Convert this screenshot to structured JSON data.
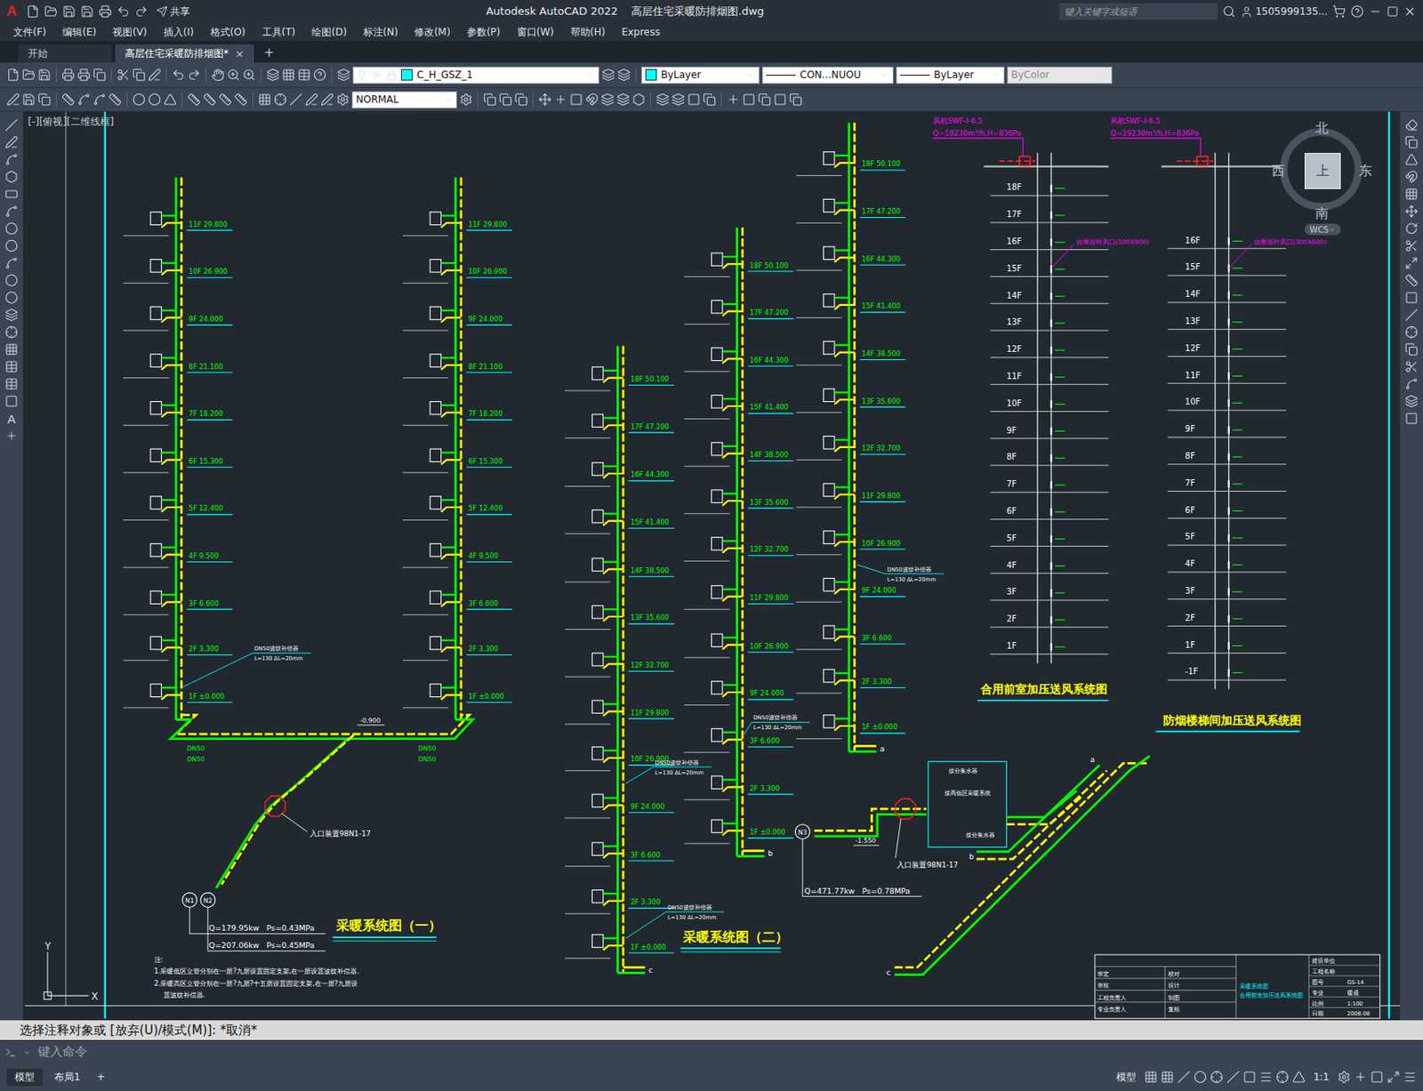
{
  "window": {
    "logo": "A",
    "title": "Autodesk AutoCAD 2022    高层住宅采暖防排烟图.dwg",
    "share": "共享",
    "search_placeholder": "键入关键字或短语",
    "user": "1505999135..."
  },
  "menu": [
    "文件(F)",
    "编辑(E)",
    "视图(V)",
    "插入(I)",
    "格式(O)",
    "工具(T)",
    "绘图(D)",
    "标注(N)",
    "修改(M)",
    "参数(P)",
    "窗口(W)",
    "帮助(H)",
    "Express"
  ],
  "doc_tabs": [
    {
      "label": "开始",
      "selected": false,
      "closable": false
    },
    {
      "label": "高层住宅采暖防排烟图*",
      "selected": true,
      "closable": true
    }
  ],
  "doc_tab_close": "×",
  "doc_tab_add": "+",
  "properties": {
    "layer": "C_H_GSZ_1",
    "color": "ByLayer",
    "linetype": "CON...NUOU",
    "lineweight": "ByLayer",
    "plotstyle": "ByColor"
  },
  "style_combo": "NORMAL",
  "text_tool": "A",
  "viewport_label": "[-][俯视][二维线框]",
  "viewcube": {
    "north": "北",
    "south": "南",
    "east": "东",
    "west": "西",
    "face": "上",
    "ucs": "WCS"
  },
  "ucs_axes": {
    "x": "X",
    "y": "Y"
  },
  "drawing": {
    "system1": {
      "title": "采暖系统图（一）",
      "risers": [
        {
          "levels": [
            "11F 29.800",
            "10F 26.900",
            "9F 24.000",
            "8F 21.100",
            "7F 18.200",
            "6F 15.300",
            "5F 12.400",
            "4F 9.500",
            "3F 6.600",
            "2F 3.300",
            "1F ±0.000"
          ]
        },
        {
          "levels": [
            "11F 29.800",
            "10F 26.900",
            "9F 24.000",
            "8F 21.100",
            "7F 18.200",
            "6F 15.300",
            "5F 12.400",
            "4F 9.500",
            "3F 6.600",
            "2F 3.300",
            "1F ±0.000"
          ]
        }
      ],
      "elevation": "-0.900",
      "entry": "入口装置98N1-17",
      "nodes": [
        "N1",
        "N2"
      ],
      "loads": [
        "Q=179.95kw   Ps=0.43MPa",
        "Q=207.06kw   Ps=0.45MPa"
      ],
      "pipe_labels": [
        "DN50",
        "DN50",
        "DN50",
        "DN50"
      ],
      "callout": [
        "DN50波纹补偿器",
        "L=130  ΔL=20mm"
      ],
      "notes": [
        "注:",
        "1.采暖低区立管分别在一层?九层设置固定支架,在一层设置波纹补偿器.",
        "2.采暖高区立管分别在一层?九层?十五层设置固定支架,在一层?九层设",
        "置波纹补偿器."
      ]
    },
    "system2": {
      "title": "采暖系统图（二）",
      "risers": [
        {
          "levels": [
            "18F 50.100",
            "17F 47.200",
            "16F 44.300",
            "15F 41.400",
            "14F 38.500",
            "13F 35.600",
            "12F 32.700",
            "11F 29.800",
            "10F 26.900",
            "9F 24.000",
            "3F 6.600",
            "2F 3.300",
            "1F ±0.000"
          ],
          "end": "c"
        },
        {
          "levels": [
            "18F 50.100",
            "17F 47.200",
            "16F 44.300",
            "15F 41.400",
            "14F 38.500",
            "13F 35.600",
            "12F 32.700",
            "11F 29.800",
            "10F 26.900",
            "9F 24.000",
            "3F 6.600",
            "2F 3.300",
            "1F ±0.000"
          ],
          "end": "b"
        },
        {
          "levels": [
            "18F 50.100",
            "17F 47.200",
            "16F 44.300",
            "15F 41.400",
            "14F 38.500",
            "13F 35.600",
            "12F 32.700",
            "11F 29.800",
            "10F 26.900",
            "9F 24.000",
            "3F 6.600",
            "2F 3.300",
            "1F ±0.000"
          ],
          "end": "a"
        }
      ],
      "elevation": "-1.550",
      "entry": "入口装置98N1-17",
      "node": "N3",
      "load": "Q=471.77kw   Ps=0.78MPa",
      "box": [
        "接分集水器",
        "接高低区采暖系统",
        "接分集水器"
      ],
      "ends": [
        "c",
        "a",
        "b"
      ],
      "callout": [
        "DN50波纹补偿器",
        "L=130  ΔL=20mm"
      ]
    },
    "charts": [
      {
        "title": "合用前室加压送风系统图",
        "fan": "风机SWF-I-6.5",
        "spec": "Q=19230m³/h,H=836Pa",
        "vent": "自垂百叶风口(300X900)",
        "floors": [
          "18F",
          "17F",
          "16F",
          "15F",
          "14F",
          "13F",
          "12F",
          "11F",
          "10F",
          "9F",
          "8F",
          "7F",
          "6F",
          "5F",
          "4F",
          "3F",
          "2F",
          "1F"
        ]
      },
      {
        "title": "防烟楼梯间加压送风系统图",
        "fan": "风机SWF-I-6.5",
        "spec": "Q=19230m³/h,H=836Pa",
        "vent": "自垂百叶风口(300X600)",
        "floors": [
          "16F",
          "15F",
          "14F",
          "13F",
          "12F",
          "11F",
          "10F",
          "9F",
          "8F",
          "7F",
          "6F",
          "5F",
          "4F",
          "3F",
          "2F",
          "1F",
          "-1F"
        ]
      }
    ],
    "title_block": {
      "left": [
        [
          "审定",
          "校对"
        ],
        [
          "审核",
          "设计"
        ],
        [
          "工程负责人",
          "制图"
        ],
        [
          "专业负责人",
          "复核"
        ]
      ],
      "sheet": [
        "采暖系统图",
        "合用前室加压送风系统图"
      ],
      "right": [
        [
          "建设单位",
          ""
        ],
        [
          "工程名称",
          ""
        ],
        [
          "图号",
          "GS-14"
        ],
        [
          "专业",
          "暖通"
        ],
        [
          "比例",
          "1:100"
        ],
        [
          "日期",
          "2008.08"
        ]
      ]
    }
  },
  "command": {
    "history": "选择注释对象或 [放弃(U)/模式(M)]: *取消*",
    "placeholder": "键入命令"
  },
  "status_bar": {
    "tabs": [
      {
        "label": "模型",
        "selected": true
      },
      {
        "label": "布局1",
        "selected": false
      }
    ],
    "add": "+",
    "space": "模型",
    "scale": "1:1"
  }
}
